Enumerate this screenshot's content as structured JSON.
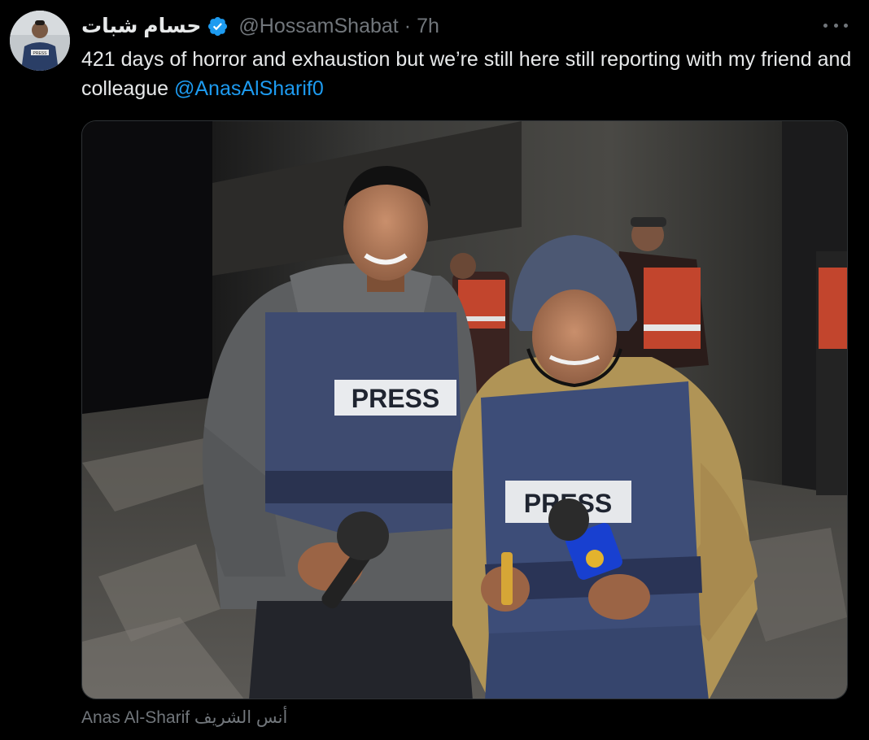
{
  "tweet": {
    "author": {
      "display_name": "حسام شبات",
      "handle": "@HossamShabat",
      "verified": true
    },
    "separator": "·",
    "time": "7h",
    "text_before_mention": "421 days of horror and exhaustion but we’re still here still reporting with my friend and colleague ",
    "mention": "@AnasAlSharif0",
    "media": {
      "vest_label_left": "PRESS",
      "vest_label_right": "PRESS",
      "tagged_caption": "أنس الشريف Anas Al-Sharif"
    }
  },
  "colors": {
    "background": "#000000",
    "text": "#e7e9ea",
    "secondary": "#71767b",
    "link": "#1d9bf0",
    "verified": "#1d9bf0",
    "border": "#2f3336"
  },
  "icons": [
    "verified-badge-icon",
    "more-options-icon"
  ]
}
